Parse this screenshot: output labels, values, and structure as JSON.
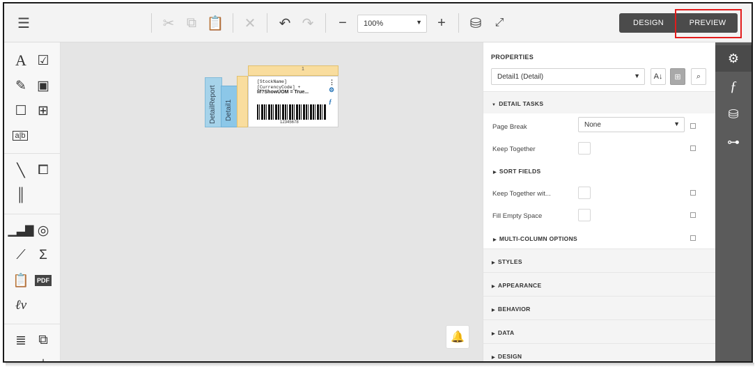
{
  "toolbar": {
    "zoom_value": "100%",
    "design_label": "DESIGN",
    "preview_label": "PREVIEW",
    "icons": [
      "menu-icon",
      "cut-icon",
      "copy-icon",
      "paste-icon",
      "delete-icon",
      "undo-icon",
      "redo-icon",
      "zoom-out-icon",
      "zoom-in-icon",
      "validate-icon",
      "fullscreen-icon"
    ]
  },
  "canvas": {
    "band_outer_label": "DetailReport",
    "band_inner_label": "Detail1",
    "ruler_mark": "1",
    "fields": [
      "[StockName]",
      "[CurrencyCode] +",
      "Iif?ShowUOM = True..."
    ],
    "barcode_text": "12345678"
  },
  "properties": {
    "title": "PROPERTIES",
    "selected_component": "Detail1 (Detail)",
    "sections": {
      "detail_tasks": "DETAIL TASKS",
      "sort_fields": "SORT FIELDS",
      "multi_column": "MULTI-COLUMN OPTIONS",
      "styles": "STYLES",
      "appearance": "APPEARANCE",
      "behavior": "BEHAVIOR",
      "data": "DATA",
      "design": "DESIGN"
    },
    "page_break_label": "Page Break",
    "page_break_value": "None",
    "keep_together_label": "Keep Together",
    "keep_together_with_label": "Keep Together wit...",
    "fill_empty_label": "Fill Empty Space"
  },
  "colors": {
    "accent_dark": "#4b4b4b",
    "highlight_red": "#e31b1b",
    "band_blue": "#8cc7e8",
    "ruler_yellow": "#f9dd9e"
  }
}
